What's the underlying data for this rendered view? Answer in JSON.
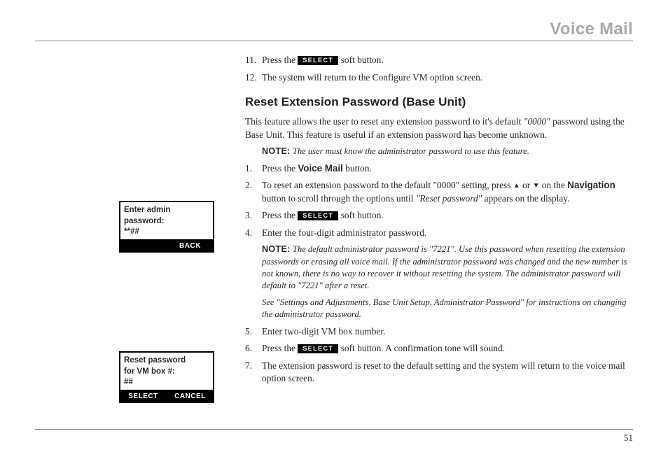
{
  "header": {
    "title": "Voice Mail"
  },
  "selectLabel": "SELECT",
  "intro": {
    "num11": "11.",
    "text11a": "Press the ",
    "text11b": " soft button.",
    "num12": "12.",
    "text12": "The system will return to the Configure VM option screen."
  },
  "section": {
    "heading": "Reset Extension Password (Base Unit)",
    "lead_a": "This feature allows the user to reset any extension password to it's default ",
    "lead_default": "\"0000\"",
    "lead_b": " password using the Base Unit. This feature is useful if an extension password has become unknown.",
    "note1_label": "NOTE:",
    "note1_body": " The user must know the administrator password to use this feature.",
    "s1_num": "1.",
    "s1_a": "Press the ",
    "s1_bold": "Voice Mail",
    "s1_b": " button.",
    "s2_num": "2.",
    "s2_a": "To reset an extension password to the default \"0000\" setting, press ",
    "s2_or": "  or  ",
    "s2_b": " on the ",
    "s2_bold": "Navigation",
    "s2_c": " button to scroll through the options until ",
    "s2_italic": "\"Reset password\"",
    "s2_d": " appears on the display.",
    "s3_num": "3.",
    "s3_a": "Press the ",
    "s3_b": " soft button.",
    "s4_num": "4.",
    "s4_a": "Enter the four-digit administrator password.",
    "note2_label": "NOTE:",
    "note2_body": " The default administrator password is \"7221\". Use this password when resetting the extension passwords or erasing all voice mail. If the administrator password  was changed and the new number is not known, there is no way to recover it without resetting the system. The administrator password will default to \"7221\" after a reset.",
    "note3_body": "See \"Settings and Adjustments, Base Unit Setup, Administrator Password\" for instructions  on changing the administrator password.",
    "s5_num": "5.",
    "s5_a": "Enter two-digit VM box number.",
    "s6_num": "6.",
    "s6_a": "Press the  ",
    "s6_b": "  soft button. A confirmation tone will sound.",
    "s7_num": "7.",
    "s7_a": "The extension password is reset to the default setting and the system will return to the voice mail option screen."
  },
  "lcd1": {
    "line1": "Enter admin",
    "line2": "password:",
    "line3": "**##",
    "sk_left": "",
    "sk_right": "BACK"
  },
  "lcd2": {
    "line1": "Reset password",
    "line2": "for VM box #:",
    "line3": "##",
    "sk_left": "SELECT",
    "sk_right": "CANCEL"
  },
  "footer": {
    "pageNumber": "51"
  }
}
